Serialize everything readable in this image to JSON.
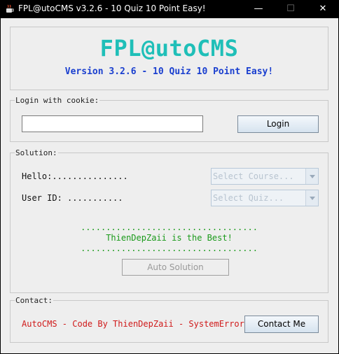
{
  "window": {
    "title": "FPL@utoCMS v3.2.6 - 10 Quiz 10 Point Easy!",
    "icon": "java-cup-icon",
    "controls": {
      "minimize": "—",
      "maximize": "☐",
      "close": "✕"
    }
  },
  "header": {
    "brand": "FPL@utoCMS",
    "version": "Version 3.2.6 - 10 Quiz 10 Point Easy!",
    "colors": {
      "brand": "#1fbfb8",
      "version": "#1a3fcf"
    }
  },
  "login": {
    "legend": "Login with cookie:",
    "cookie_value": "",
    "button": "Login"
  },
  "solution": {
    "legend": "Solution:",
    "hello_label": "Hello:...............",
    "userid_label": "User ID: ...........",
    "course_placeholder": "Select Course...",
    "quiz_placeholder": "Select Quiz...",
    "dots_top": "...................................",
    "credit": "ThienDepZaii is the Best!",
    "dots_bottom": "...................................",
    "auto_button": "Auto Solution"
  },
  "contact": {
    "legend": "Contact:",
    "text": "AutoCMS - Code By ThienDepZaii - SystemError",
    "button": "Contact Me",
    "colors": {
      "text": "#d01a1a"
    }
  }
}
